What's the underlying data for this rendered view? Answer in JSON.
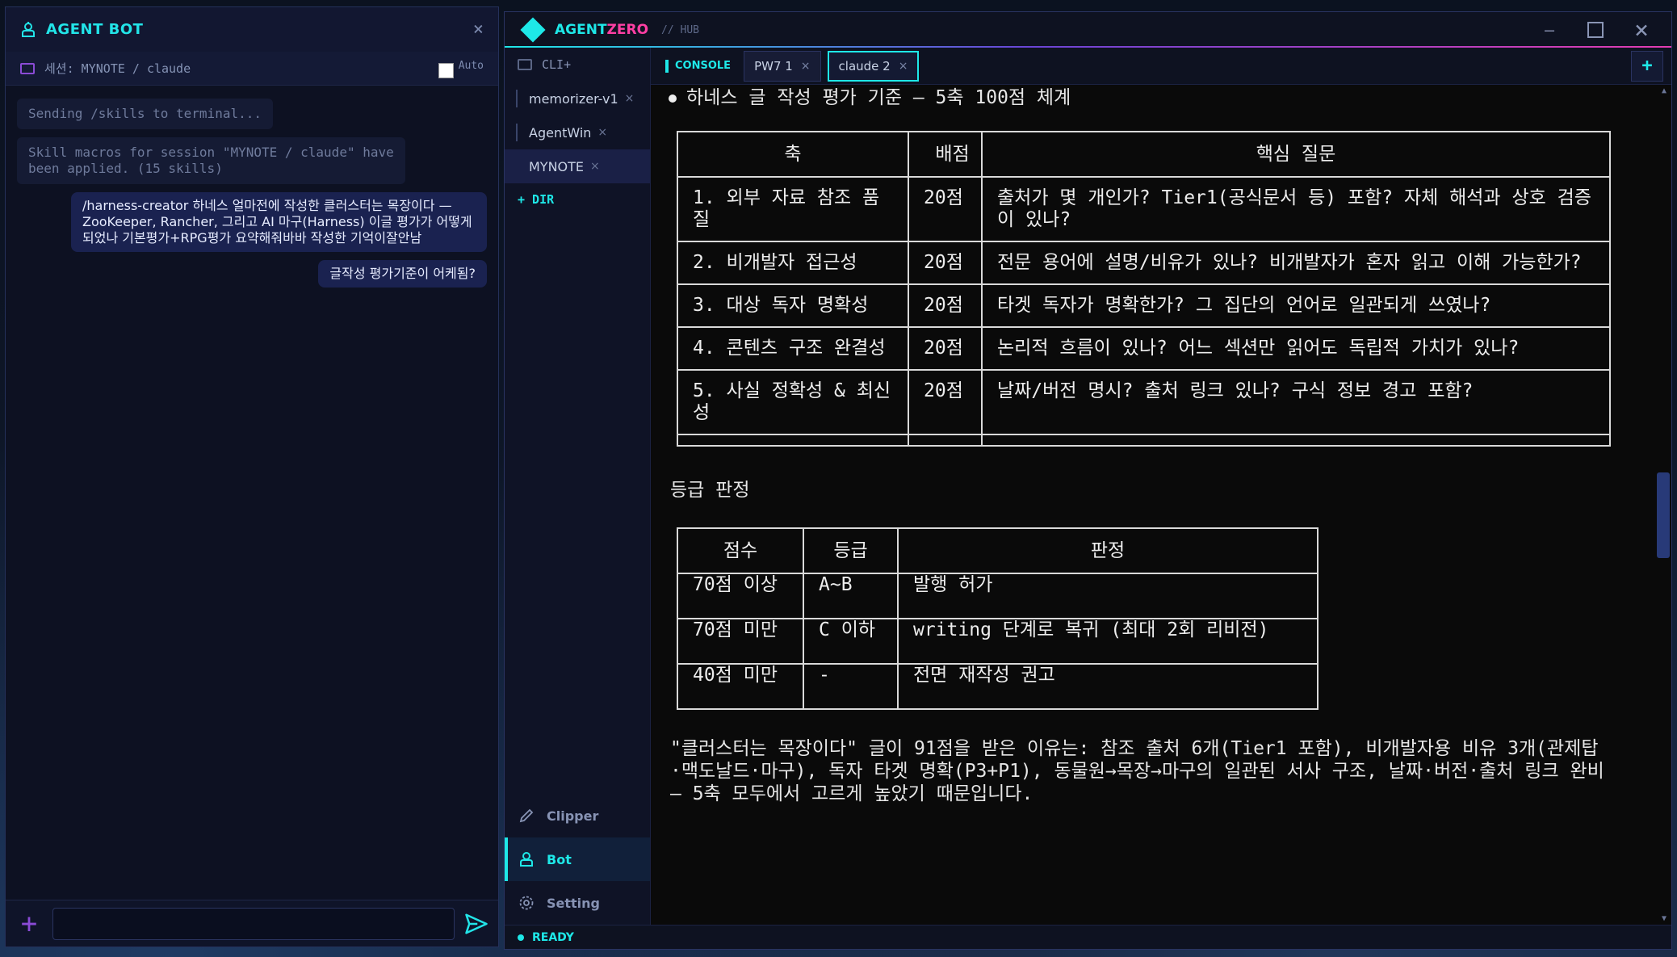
{
  "bot": {
    "title": "AGENT BOT",
    "close": "×",
    "session": "세션: MYNOTE / claude",
    "auto_label": "Auto",
    "messages": {
      "sys1": "Sending /skills to terminal...",
      "sys2": "Skill macros for session \"MYNOTE / claude\" have\nbeen applied. (15 skills)",
      "user1": "/harness-creator 하네스 얼마전에 작성한 클러스터는 목장이다 — ZooKeeper, Rancher, 그리고 AI 마구(Harness) 이글 평가가 어떻게 되었나 기본평가+RPG평가 요약해줘바바 작성한 기억이잘안남",
      "user2": "글작성 평가기준이 어케됨?"
    },
    "input_placeholder": "",
    "plus": "+"
  },
  "az": {
    "brand_a": "AGENT",
    "brand_z": "ZERO",
    "hub": "// HUB",
    "sidebar": {
      "cli": "CLI+",
      "items": [
        {
          "label": "memorizer-v1",
          "x": "×"
        },
        {
          "label": "AgentWin",
          "x": "×"
        },
        {
          "label": "MYNOTE",
          "x": "×"
        }
      ],
      "dir": "+ DIR",
      "nav": [
        "Clipper",
        "Bot",
        "Setting"
      ]
    },
    "tabs": {
      "console": "CONSOLE",
      "items": [
        {
          "label": "PW7 1",
          "x": "×"
        },
        {
          "label": "claude 2",
          "x": "×"
        }
      ],
      "add": "+"
    },
    "status": "READY"
  },
  "console": {
    "heading": "하네스 글 작성 평가 기준 — 5축 100점 체계",
    "table1": {
      "headers": [
        "축",
        "배점",
        "핵심 질문"
      ],
      "rows": [
        [
          "1. 외부 자료 참조 품질",
          "20점",
          "출처가 몇 개인가? Tier1(공식문서 등) 포함? 자체 해석과 상호 검증이 있나?"
        ],
        [
          "2. 비개발자 접근성",
          "20점",
          "전문 용어에 설명/비유가 있나? 비개발자가 혼자 읽고 이해 가능한가?"
        ],
        [
          "3. 대상 독자 명확성",
          "20점",
          "타겟 독자가 명확한가? 그 집단의 언어로 일관되게 쓰였나?"
        ],
        [
          "4. 콘텐츠 구조 완결성",
          "20점",
          "논리적 흐름이 있나? 어느 섹션만 읽어도 독립적 가치가 있나?"
        ],
        [
          "5. 사실 정확성 & 최신성",
          "20점",
          "날짜/버전 명시? 출처 링크 있나? 구식 정보 경고 포함?"
        ]
      ]
    },
    "subheading": "등급 판정",
    "table2": {
      "headers": [
        "점수",
        "등급",
        "판정"
      ],
      "rows": [
        [
          "70점 이상",
          "A~B",
          "발행 허가"
        ],
        [
          "70점 미만",
          "C 이하",
          "writing 단계로 복귀 (최대 2회 리비전)"
        ],
        [
          "40점 미만",
          "-",
          "전면 재작성 권고"
        ]
      ]
    },
    "paragraph": "\"클러스터는 목장이다\" 글이 91점을 받은 이유는: 참조 출처 6개(Tier1 포함), 비개발자용 비유 3개(관제탑·맥도날드·마구), 독자 타겟 명확(P3+P1), 동물원→목장→마구의 일관된 서사 구조, 날짜·버전·출처 링크 완비 — 5축 모두에서 고르게 높았기 때문입니다."
  },
  "colors": {
    "accent_cyan": "#1ee8e8",
    "accent_pink": "#ff3fa4",
    "accent_purple": "#8a4bd6"
  }
}
